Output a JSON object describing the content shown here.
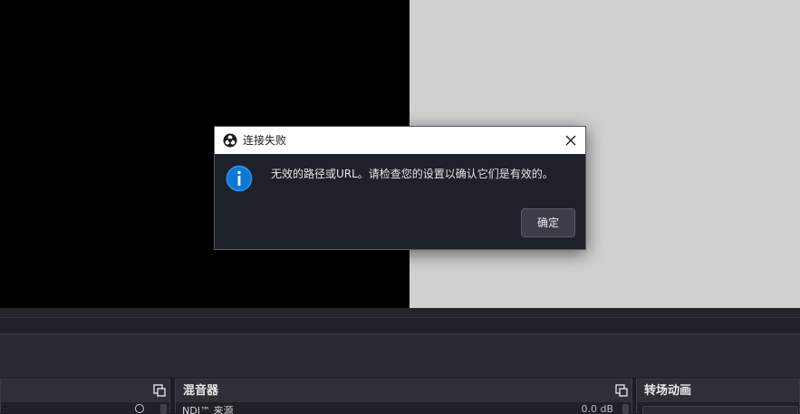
{
  "dialog": {
    "title": "连接失败",
    "message": "无效的路径或URL。请检查您的设置以确认它们是有效的。",
    "ok_label": "确定",
    "icons": {
      "app": "obs-logo-icon",
      "close": "close-icon",
      "info": "info-icon"
    },
    "accent_color": "#0a78d7"
  },
  "docks": [
    {
      "title": "",
      "float_icon": "float-dock-icon"
    },
    {
      "title": "混音器",
      "float_icon": "float-dock-icon",
      "row_label": "NDI™ 来源",
      "row_value": "0.0 dB"
    },
    {
      "title": "转场动画"
    }
  ]
}
